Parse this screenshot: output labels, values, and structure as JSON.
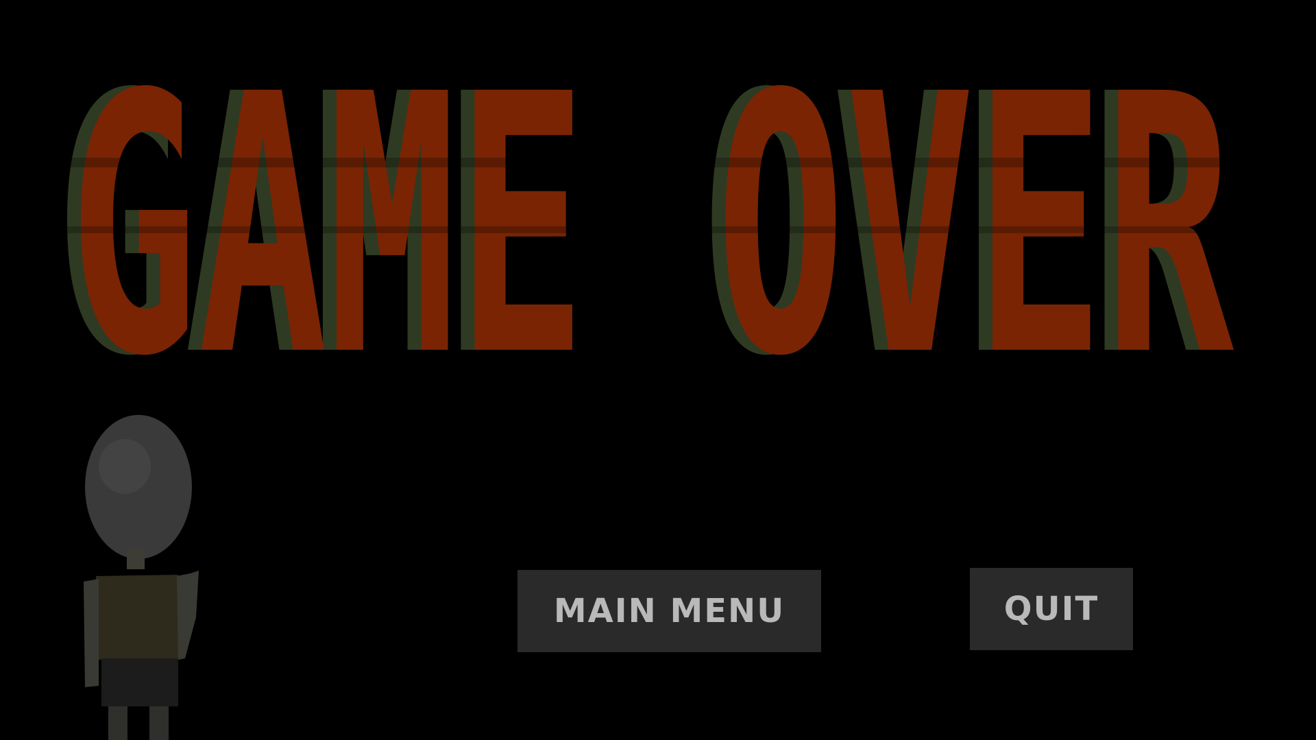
{
  "screen": {
    "title": "GAME OVER",
    "background_color": "#000000",
    "title_color": "#7a2404",
    "title_shadow_color": "#2f3a22"
  },
  "buttons": {
    "main_menu_label": "MAIN MENU",
    "quit_label": "QUIT",
    "button_bg_color": "#2a2a2a",
    "button_text_color": "#b9b9b9"
  },
  "character": {
    "icon": "boy-character-icon"
  }
}
